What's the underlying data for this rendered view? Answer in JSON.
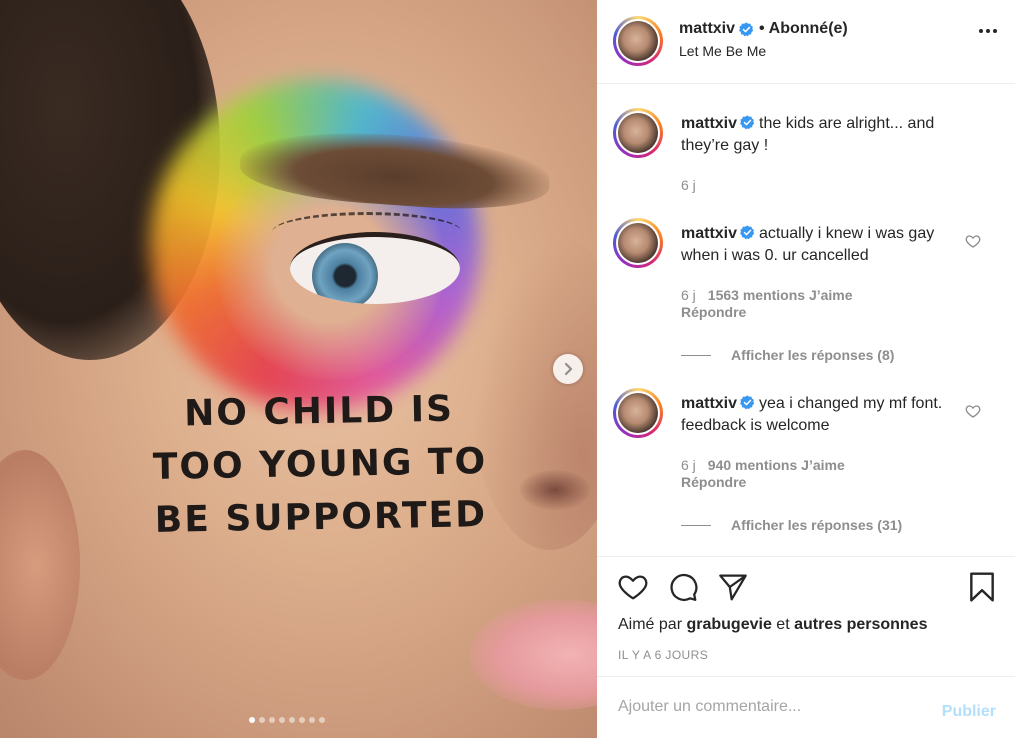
{
  "media": {
    "overlay_text_lines": [
      "NO CHILD IS",
      "TOO YOUNG TO",
      "BE SUPPORTED"
    ],
    "carousel": {
      "total": 8,
      "active_index": 0
    }
  },
  "header": {
    "username": "mattxiv",
    "separator": "•",
    "follow_status": "Abonné(e)",
    "location": "Let Me Be Me"
  },
  "comments": [
    {
      "username": "mattxiv",
      "text": "the kids are alright... and they’re gay !",
      "time": "6 j"
    },
    {
      "username": "mattxiv",
      "text": "actually i knew i was gay when i was 0. ur cancelled",
      "time": "6 j",
      "likes": "1563 mentions J’aime",
      "reply": "Répondre",
      "view_replies": "Afficher les réponses (8)"
    },
    {
      "username": "mattxiv",
      "text": "yea i changed my mf font. feedback is welcome",
      "time": "6 j",
      "likes": "940 mentions J’aime",
      "reply": "Répondre",
      "view_replies": "Afficher les réponses (31)"
    }
  ],
  "likes": {
    "prefix": "Aimé par",
    "user": "grabugevie",
    "conjunction": "et",
    "others": "autres personnes"
  },
  "timestamp": "IL Y A 6 JOURS",
  "add_comment": {
    "placeholder": "Ajouter un commentaire...",
    "publish_label": "Publier"
  },
  "colors": {
    "verified": "#3897f0",
    "text": "#262626",
    "muted": "#8e8e8e",
    "publish_disabled": "#b2dffc"
  }
}
